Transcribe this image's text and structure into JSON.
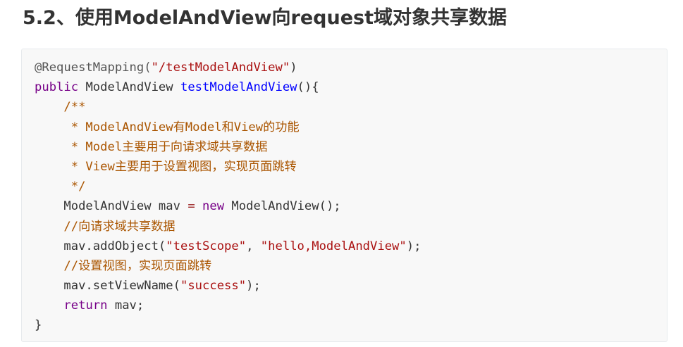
{
  "heading": "5.2、使用ModelAndView向request域对象共享数据",
  "code": {
    "lines": [
      [
        {
          "text": "@RequestMapping(",
          "kind": "annotation"
        },
        {
          "text": "\"/testModelAndView\"",
          "kind": "string"
        },
        {
          "text": ")",
          "kind": "plain"
        }
      ],
      [
        {
          "text": "public",
          "kind": "keyword"
        },
        {
          "text": " ModelAndView ",
          "kind": "plain"
        },
        {
          "text": "testModelAndView",
          "kind": "def"
        },
        {
          "text": "(){",
          "kind": "plain"
        }
      ],
      [
        {
          "text": "    /**",
          "kind": "comment"
        }
      ],
      [
        {
          "text": "     * ModelAndView有Model和View的功能",
          "kind": "comment"
        }
      ],
      [
        {
          "text": "     * Model主要用于向请求域共享数据",
          "kind": "comment"
        }
      ],
      [
        {
          "text": "     * View主要用于设置视图，实现页面跳转",
          "kind": "comment"
        }
      ],
      [
        {
          "text": "     */",
          "kind": "comment"
        }
      ],
      [
        {
          "text": "    ModelAndView mav ",
          "kind": "plain"
        },
        {
          "text": "=",
          "kind": "operator"
        },
        {
          "text": " ",
          "kind": "plain"
        },
        {
          "text": "new",
          "kind": "keyword"
        },
        {
          "text": " ModelAndView();",
          "kind": "plain"
        }
      ],
      [
        {
          "text": "    //向请求域共享数据",
          "kind": "comment"
        }
      ],
      [
        {
          "text": "    mav.addObject(",
          "kind": "plain"
        },
        {
          "text": "\"testScope\"",
          "kind": "string"
        },
        {
          "text": ", ",
          "kind": "plain"
        },
        {
          "text": "\"hello,ModelAndView\"",
          "kind": "string"
        },
        {
          "text": ");",
          "kind": "plain"
        }
      ],
      [
        {
          "text": "    //设置视图，实现页面跳转",
          "kind": "comment"
        }
      ],
      [
        {
          "text": "    mav.setViewName(",
          "kind": "plain"
        },
        {
          "text": "\"success\"",
          "kind": "string"
        },
        {
          "text": ");",
          "kind": "plain"
        }
      ],
      [
        {
          "text": "    ",
          "kind": "plain"
        },
        {
          "text": "return",
          "kind": "keyword"
        },
        {
          "text": " mav;",
          "kind": "plain"
        }
      ],
      [
        {
          "text": "}",
          "kind": "plain"
        }
      ]
    ]
  }
}
